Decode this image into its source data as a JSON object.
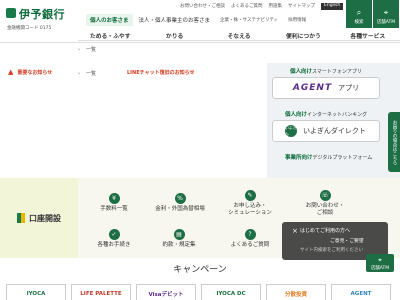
{
  "header": {
    "bank_name": "伊予銀行",
    "bank_code": "金融機関コード 0175",
    "top_links": [
      "お問い合わせ・ご相談",
      "よくあるご質問",
      "用語集",
      "サイトマップ"
    ],
    "english": "English",
    "tabs": [
      "個人のお客さま",
      "法人・個人事業主のお客さま"
    ],
    "tabs_small": [
      "企業・株・サステナビリティ",
      "採用情報"
    ],
    "search_label": "検索",
    "atm_label": "店舗ATM"
  },
  "nav": {
    "items": [
      "ためる・ふやす",
      "かりる",
      "そなえる",
      "便利につかう",
      "各種サービス"
    ]
  },
  "notices": {
    "list_label_1": "一覧",
    "important_label": "重要なお知らせ",
    "list_label_2": "一覧",
    "item": "LINEチャット復旧のお知らせ"
  },
  "apps": {
    "personal_title": "個人向け",
    "personal_sub": "スマートフォンアプリ",
    "agent_logo": "AGENT",
    "agent_label": "アプリ",
    "banking_title": "個人向け",
    "banking_sub": "インターネットバンキング",
    "direct_logo": "いよぎん",
    "direct_label": "いよぎんダイレクト",
    "biz_title": "事業所向け",
    "biz_sub": "デジタルプラットフォーム"
  },
  "side_tab": "お困りの場合はこちら",
  "services": {
    "account_label": "口座開設",
    "tiles": [
      {
        "label": "手数料一覧",
        "icon": "¥"
      },
      {
        "label": "金利・外国為替相場",
        "icon": "%"
      },
      {
        "label": "お申し込み・\nシミュレーション",
        "icon": "✎"
      },
      {
        "label": "お問い合わせ・\nご相談",
        "icon": "☏"
      },
      {
        "label": "各種お手続き",
        "icon": "✓"
      },
      {
        "label": "約款・規定集",
        "icon": "▤"
      },
      {
        "label": "よくあるご質問",
        "icon": "?"
      }
    ]
  },
  "chat": {
    "close": "×",
    "question": "はじめてご利用の方へ",
    "sub": "サイト内検索をご利用ください",
    "side": "ご意見・ご要望",
    "badge_label": "店舗ATM"
  },
  "campaign": {
    "title": "キャンペーン",
    "cards": [
      {
        "text": "IYOCA",
        "color": "#1d6e44"
      },
      {
        "text": "LIFE PALETTE",
        "color": "#c0392b"
      },
      {
        "text": "Visaデビット",
        "color": "#5b2c8a"
      },
      {
        "text": "IYOCA DC",
        "color": "#1d6e44"
      },
      {
        "text": "分散投資",
        "color": "#e67e22"
      },
      {
        "text": "AGENT",
        "color": "#2e86c1"
      }
    ]
  }
}
